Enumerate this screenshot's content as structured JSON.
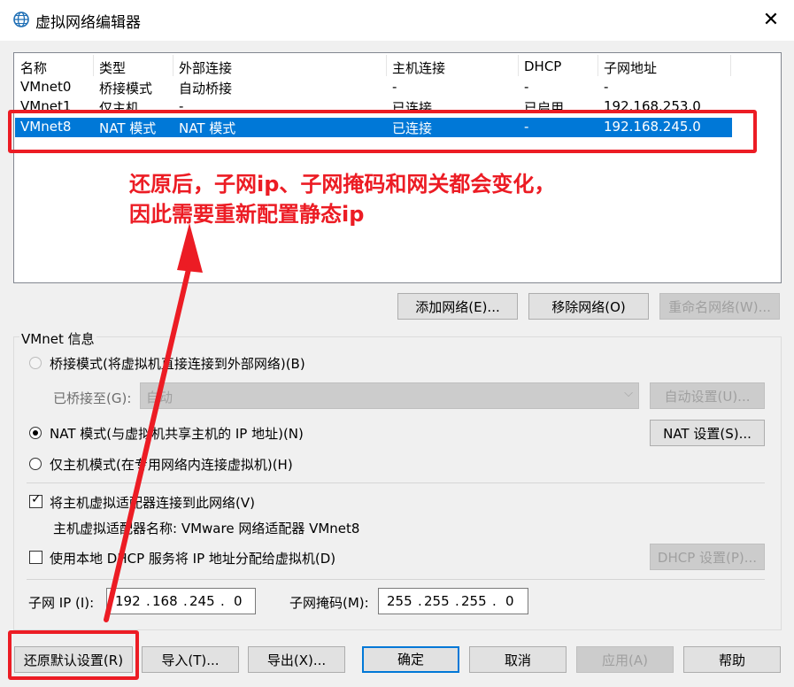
{
  "window": {
    "title": "虚拟网络编辑器"
  },
  "columns": [
    "名称",
    "类型",
    "外部连接",
    "主机连接",
    "DHCP",
    "子网地址"
  ],
  "rows": [
    [
      "VMnet0",
      "桥接模式",
      "自动桥接",
      "-",
      "-",
      "-"
    ],
    [
      "VMnet1",
      "仅主机",
      "-",
      "已连接",
      "已启用",
      "192.168.253.0"
    ],
    [
      "VMnet8",
      "NAT 模式",
      "NAT 模式",
      "已连接",
      "-",
      "192.168.245.0"
    ]
  ],
  "list_buttons": {
    "add": "添加网络(E)...",
    "remove": "移除网络(O)",
    "rename": "重命名网络(W)..."
  },
  "vmnet_info": {
    "group_label": "VMnet 信息",
    "bridged_radio": "桥接模式(将虚拟机直接连接到外部网络)(B)",
    "bridged_to_label": "已桥接至(G):",
    "bridged_to_value": "自动",
    "auto_settings": "自动设置(U)...",
    "nat_radio": "NAT 模式(与虚拟机共享主机的 IP 地址)(N)",
    "nat_settings": "NAT 设置(S)...",
    "hostonly_radio": "仅主机模式(在专用网络内连接虚拟机)(H)",
    "connect_adapter": "将主机虚拟适配器连接到此网络(V)",
    "adapter_name": "主机虚拟适配器名称: VMware 网络适配器 VMnet8",
    "use_dhcp": "使用本地 DHCP 服务将 IP 地址分配给虚拟机(D)",
    "dhcp_settings": "DHCP 设置(P)...",
    "subnet_ip_label": "子网 IP (I):",
    "subnet_ip": [
      "192",
      "168",
      "245",
      "0"
    ],
    "subnet_mask_label": "子网掩码(M):",
    "subnet_mask": [
      "255",
      "255",
      "255",
      "0"
    ]
  },
  "bottom_buttons": {
    "restore": "还原默认设置(R)",
    "import": "导入(T)...",
    "export": "导出(X)...",
    "ok": "确定",
    "cancel": "取消",
    "apply": "应用(A)",
    "help": "帮助"
  },
  "annotation": {
    "line1": "还原后，子网ip、子网掩码和网关都会变化，",
    "line2": "因此需要重新配置静态ip",
    "color": "#ec1c24"
  },
  "colors": {
    "selection": "#0078d7",
    "button_face": "#e1e1e1",
    "annotation_red": "#ec1c24"
  }
}
